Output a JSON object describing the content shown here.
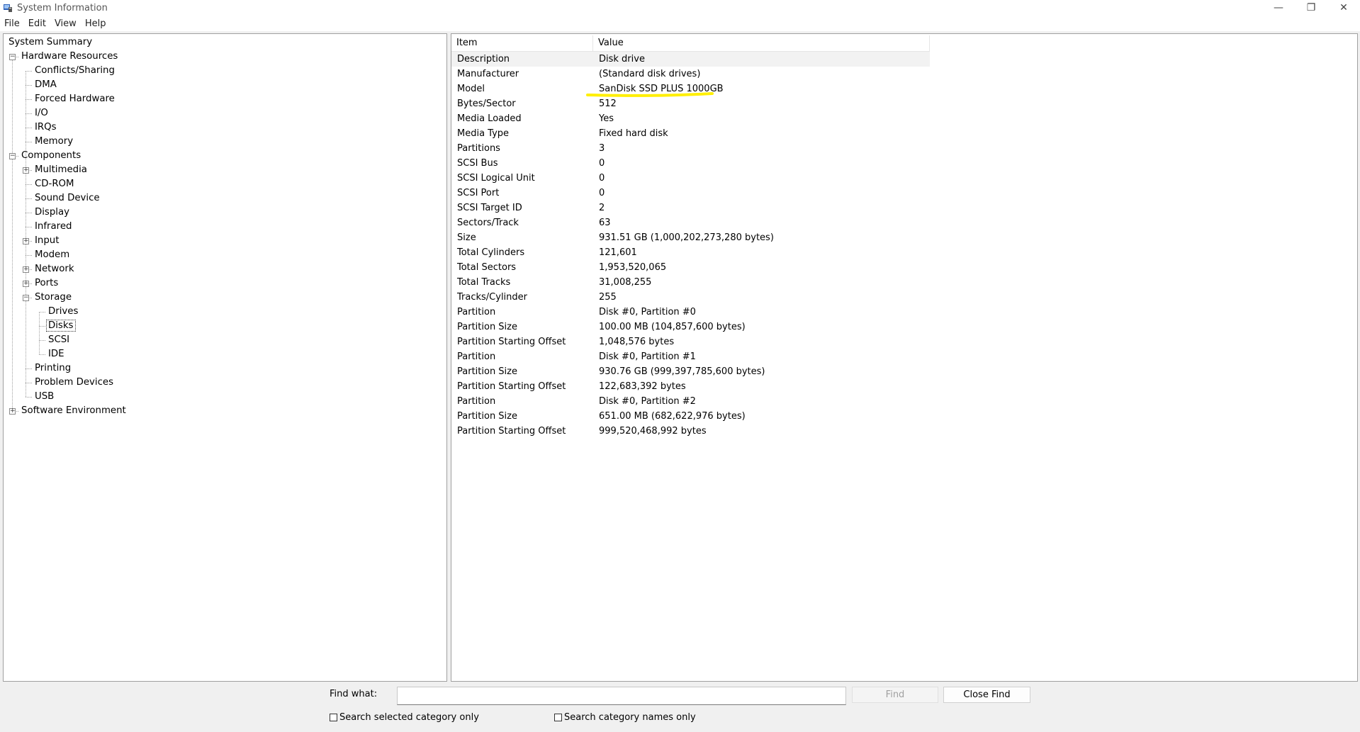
{
  "window": {
    "title": "System Information"
  },
  "menu": [
    "File",
    "Edit",
    "View",
    "Help"
  ],
  "tree": [
    {
      "label": "System Summary",
      "level": 0,
      "expander": "",
      "row": 0
    },
    {
      "label": "Hardware Resources",
      "level": 1,
      "expander": "−",
      "row": 1
    },
    {
      "label": "Conflicts/Sharing",
      "level": 2,
      "expander": "",
      "row": 2
    },
    {
      "label": "DMA",
      "level": 2,
      "expander": "",
      "row": 3
    },
    {
      "label": "Forced Hardware",
      "level": 2,
      "expander": "",
      "row": 4
    },
    {
      "label": "I/O",
      "level": 2,
      "expander": "",
      "row": 5
    },
    {
      "label": "IRQs",
      "level": 2,
      "expander": "",
      "row": 6
    },
    {
      "label": "Memory",
      "level": 2,
      "expander": "",
      "row": 7
    },
    {
      "label": "Components",
      "level": 1,
      "expander": "−",
      "row": 8
    },
    {
      "label": "Multimedia",
      "level": 2,
      "expander": "+",
      "row": 9
    },
    {
      "label": "CD-ROM",
      "level": 2,
      "expander": "",
      "row": 10
    },
    {
      "label": "Sound Device",
      "level": 2,
      "expander": "",
      "row": 11
    },
    {
      "label": "Display",
      "level": 2,
      "expander": "",
      "row": 12
    },
    {
      "label": "Infrared",
      "level": 2,
      "expander": "",
      "row": 13
    },
    {
      "label": "Input",
      "level": 2,
      "expander": "+",
      "row": 14
    },
    {
      "label": "Modem",
      "level": 2,
      "expander": "",
      "row": 15
    },
    {
      "label": "Network",
      "level": 2,
      "expander": "+",
      "row": 16
    },
    {
      "label": "Ports",
      "level": 2,
      "expander": "+",
      "row": 17
    },
    {
      "label": "Storage",
      "level": 2,
      "expander": "−",
      "row": 18
    },
    {
      "label": "Drives",
      "level": 3,
      "expander": "",
      "row": 19
    },
    {
      "label": "Disks",
      "level": 3,
      "expander": "",
      "row": 20,
      "selected": true
    },
    {
      "label": "SCSI",
      "level": 3,
      "expander": "",
      "row": 21
    },
    {
      "label": "IDE",
      "level": 3,
      "expander": "",
      "row": 22
    },
    {
      "label": "Printing",
      "level": 2,
      "expander": "",
      "row": 23
    },
    {
      "label": "Problem Devices",
      "level": 2,
      "expander": "",
      "row": 24
    },
    {
      "label": "USB",
      "level": 2,
      "expander": "",
      "row": 25
    },
    {
      "label": "Software Environment",
      "level": 1,
      "expander": "+",
      "row": 26
    }
  ],
  "table": {
    "headers": [
      "Item",
      "Value"
    ],
    "rows": [
      [
        "Description",
        "Disk drive"
      ],
      [
        "Manufacturer",
        "(Standard disk drives)"
      ],
      [
        "Model",
        "SanDisk SSD PLUS 1000GB"
      ],
      [
        "Bytes/Sector",
        "512"
      ],
      [
        "Media Loaded",
        "Yes"
      ],
      [
        "Media Type",
        "Fixed hard disk"
      ],
      [
        "Partitions",
        "3"
      ],
      [
        "SCSI Bus",
        "0"
      ],
      [
        "SCSI Logical Unit",
        "0"
      ],
      [
        "SCSI Port",
        "0"
      ],
      [
        "SCSI Target ID",
        "2"
      ],
      [
        "Sectors/Track",
        "63"
      ],
      [
        "Size",
        "931.51 GB (1,000,202,273,280 bytes)"
      ],
      [
        "Total Cylinders",
        "121,601"
      ],
      [
        "Total Sectors",
        "1,953,520,065"
      ],
      [
        "Total Tracks",
        "31,008,255"
      ],
      [
        "Tracks/Cylinder",
        "255"
      ],
      [
        "Partition",
        "Disk #0, Partition #0"
      ],
      [
        "Partition Size",
        "100.00 MB (104,857,600 bytes)"
      ],
      [
        "Partition Starting Offset",
        "1,048,576 bytes"
      ],
      [
        "Partition",
        "Disk #0, Partition #1"
      ],
      [
        "Partition Size",
        "930.76 GB (999,397,785,600 bytes)"
      ],
      [
        "Partition Starting Offset",
        "122,683,392 bytes"
      ],
      [
        "Partition",
        "Disk #0, Partition #2"
      ],
      [
        "Partition Size",
        "651.00 MB (682,622,976 bytes)"
      ],
      [
        "Partition Starting Offset",
        "999,520,468,992 bytes"
      ]
    ]
  },
  "highlight_color": "#ffef00",
  "find": {
    "label": "Find what:",
    "value": "",
    "find_button": "Find",
    "close_button": "Close Find",
    "chk_selected": "Search selected category only",
    "chk_names": "Search category names only"
  }
}
